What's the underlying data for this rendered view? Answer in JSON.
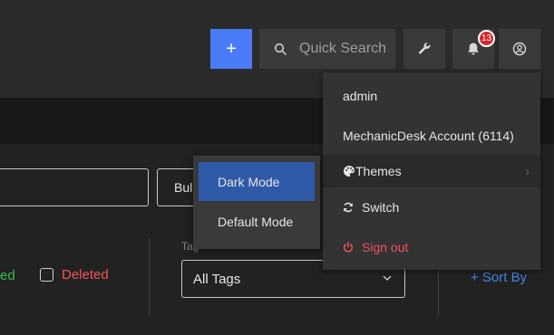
{
  "header": {
    "add_label": "+",
    "search_placeholder": "Quick Search",
    "notification_count": "13"
  },
  "user_menu": {
    "username": "admin",
    "account": "MechanicDesk Account (6114)",
    "themes": "Themes",
    "switch": "Switch",
    "signout": "Sign out"
  },
  "themes_submenu": {
    "dark": "Dark Mode",
    "default": "Default Mode",
    "selected": "Dark Mode"
  },
  "filters": {
    "bulk_label": "Bul",
    "status_partial": "ed",
    "deleted_label": "Deleted",
    "deleted_checked": false,
    "tags_label": "Tag",
    "tags_value": "All Tags",
    "sort_label": "+ Sort By"
  },
  "colors": {
    "accent": "#4a7cf7",
    "selected": "#2f5aa8",
    "danger": "#f0535c",
    "success": "#35c24a",
    "badge": "#d9262c",
    "link": "#4a86e8"
  }
}
